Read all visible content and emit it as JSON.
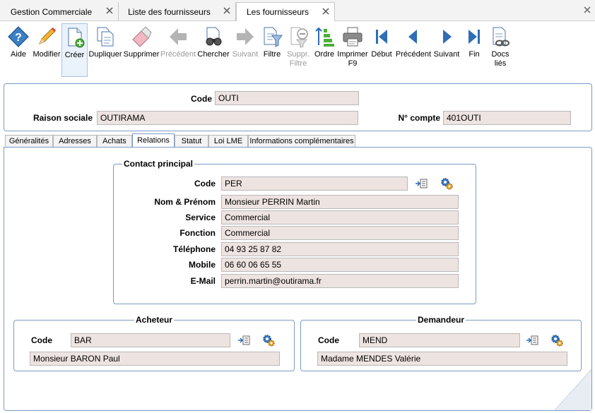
{
  "tabs": [
    {
      "label": "Gestion Commerciale"
    },
    {
      "label": "Liste des fournisseurs"
    },
    {
      "label": "Les fournisseurs"
    }
  ],
  "toolbar": {
    "aide": {
      "label": "Aide",
      "icon": "help-icon"
    },
    "modifier": {
      "label": "Modifier",
      "icon": "pencil-icon"
    },
    "creer": {
      "label": "Créer",
      "icon": "new-document-icon"
    },
    "dupliquer": {
      "label": "Dupliquer",
      "icon": "duplicate-icon"
    },
    "supprimer": {
      "label": "Supprimer",
      "icon": "eraser-icon"
    },
    "precedent_hist": {
      "label": "Précédent",
      "icon": "arrow-left-icon"
    },
    "chercher": {
      "label": "Chercher",
      "icon": "binoculars-icon"
    },
    "suivant_hist": {
      "label": "Suivant",
      "icon": "arrow-right-icon"
    },
    "filtre": {
      "label": "Filtre",
      "icon": "filter-icon"
    },
    "suppr_filtre": {
      "label1": "Suppr.",
      "label2": "Filtre",
      "icon": "remove-filter-icon"
    },
    "ordre": {
      "label": "Ordre",
      "icon": "sort-icon"
    },
    "imprimer": {
      "label1": "Imprimer",
      "label2": "F9",
      "icon": "printer-icon"
    },
    "debut": {
      "label": "Début",
      "icon": "first-record-icon"
    },
    "precedent": {
      "label": "Précédent",
      "icon": "previous-record-icon"
    },
    "suivant": {
      "label": "Suivant",
      "icon": "next-record-icon"
    },
    "fin": {
      "label": "Fin",
      "icon": "last-record-icon"
    },
    "docs": {
      "label1": "Docs",
      "label2": "liés",
      "icon": "linked-docs-icon"
    }
  },
  "header": {
    "code_label": "Code",
    "code_value": "OUTI",
    "raison_label": "Raison sociale",
    "raison_value": "OUTIRAMA",
    "compte_label": "N° compte",
    "compte_value": "401OUTI"
  },
  "subtabs": [
    "Généralités",
    "Adresses",
    "Achats",
    "Relations",
    "Statut",
    "Loi LME",
    "Informations complémentaires"
  ],
  "contact": {
    "title": "Contact principal",
    "code_label": "Code",
    "code": "PER",
    "nom_label": "Nom & Prénom",
    "nom": "Monsieur PERRIN Martin",
    "service_label": "Service",
    "service": "Commercial",
    "fonction_label": "Fonction",
    "fonction": "Commercial",
    "tel_label": "Téléphone",
    "tel": "04 93 25 87 82",
    "mobile_label": "Mobile",
    "mobile": "06 60 06 65 55",
    "email_label": "E-Mail",
    "email": "perrin.martin@outirama.fr"
  },
  "acheteur": {
    "title": "Acheteur",
    "code_label": "Code",
    "code": "BAR",
    "nom": "Monsieur BARON Paul"
  },
  "demandeur": {
    "title": "Demandeur",
    "code_label": "Code",
    "code": "MEND",
    "nom": "Madame MENDES Valérie"
  }
}
